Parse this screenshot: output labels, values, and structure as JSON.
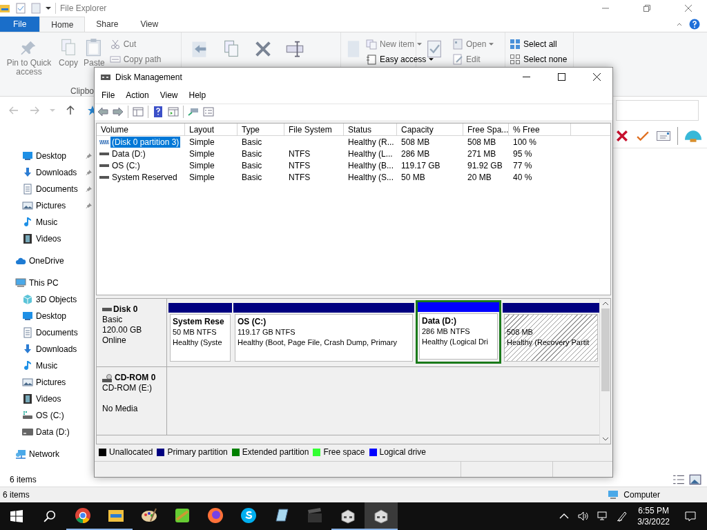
{
  "explorer": {
    "title": "File Explorer",
    "tabs": [
      {
        "label": "File",
        "kind": "file",
        "selected": false
      },
      {
        "label": "Home",
        "kind": "tab",
        "selected": true
      },
      {
        "label": "Share",
        "kind": "tab",
        "selected": false
      },
      {
        "label": "View",
        "kind": "tab",
        "selected": false
      }
    ],
    "ribbon": {
      "groups": [
        {
          "caption": "Clipbo",
          "large": [
            {
              "label": "Pin to Quick access",
              "kind": "pin",
              "disabled": true
            },
            {
              "label": "Copy",
              "kind": "copy",
              "disabled": true
            },
            {
              "label": "Paste",
              "kind": "paste",
              "disabled": true
            }
          ],
          "small": [
            {
              "label": "Cut",
              "kind": "scissors",
              "disabled": true,
              "dropdown": false
            },
            {
              "label": "Copy path",
              "kind": "path",
              "disabled": true,
              "dropdown": false
            }
          ]
        },
        {
          "large": [
            {
              "kind": "move"
            },
            {
              "kind": "copy"
            },
            {
              "kind": "delete"
            },
            {
              "kind": "rename"
            }
          ]
        },
        {
          "large": [
            {
              "kind": "newfolder"
            }
          ],
          "small": [
            {
              "label": "New item",
              "kind": "newitem",
              "disabled": true,
              "dropdown": true
            },
            {
              "label": "Easy access",
              "kind": "easy",
              "disabled": false,
              "dropdown": true
            }
          ]
        },
        {
          "large": [
            {
              "kind": "properties"
            }
          ],
          "small": [
            {
              "label": "Open",
              "kind": "open",
              "disabled": true,
              "dropdown": true
            },
            {
              "label": "Edit",
              "kind": "edit",
              "disabled": true,
              "dropdown": false
            }
          ]
        },
        {
          "small": [
            {
              "label": "Select all",
              "kind": "selectall",
              "disabled": false,
              "dropdown": false
            },
            {
              "label": "Select none",
              "kind": "selectnone",
              "disabled": false,
              "dropdown": false
            }
          ]
        }
      ]
    },
    "nav": {
      "quick_access": [
        {
          "label": "Desktop",
          "kind": "desktop",
          "pinned": true
        },
        {
          "label": "Downloads",
          "kind": "download",
          "pinned": true
        },
        {
          "label": "Documents",
          "kind": "document",
          "pinned": true
        },
        {
          "label": "Pictures",
          "kind": "picture",
          "pinned": true
        },
        {
          "label": "Music",
          "kind": "music",
          "pinned": false
        },
        {
          "label": "Videos",
          "kind": "video",
          "pinned": false
        }
      ],
      "places": [
        {
          "label": "OneDrive",
          "kind": "cloud"
        },
        {
          "label": "This PC",
          "kind": "computer",
          "children": [
            {
              "label": "3D Objects",
              "kind": "cube"
            },
            {
              "label": "Desktop",
              "kind": "desktop"
            },
            {
              "label": "Documents",
              "kind": "document"
            },
            {
              "label": "Downloads",
              "kind": "download"
            },
            {
              "label": "Music",
              "kind": "music"
            },
            {
              "label": "Pictures",
              "kind": "picture"
            },
            {
              "label": "Videos",
              "kind": "video"
            },
            {
              "label": "OS (C:)",
              "kind": "osdrive"
            },
            {
              "label": "Data (D:)",
              "kind": "drive"
            }
          ]
        },
        {
          "label": "Network",
          "kind": "network"
        }
      ]
    },
    "item_count": "6 items",
    "status_bar": {
      "count": "6 items",
      "location": "Computer"
    }
  },
  "disk_management": {
    "title": "Disk Management",
    "menu": [
      "File",
      "Action",
      "View",
      "Help"
    ],
    "table": {
      "columns": [
        "Volume",
        "Layout",
        "Type",
        "File System",
        "Status",
        "Capacity",
        "Free Spa...",
        "% Free"
      ],
      "rows": [
        {
          "kind": "recovery",
          "selected": true,
          "cells": [
            "(Disk 0 partition 3)",
            "Simple",
            "Basic",
            "",
            "Healthy (R...",
            "508 MB",
            "508 MB",
            "100 %"
          ]
        },
        {
          "kind": "drive",
          "selected": false,
          "cells": [
            "Data (D:)",
            "Simple",
            "Basic",
            "NTFS",
            "Healthy (L...",
            "286 MB",
            "271 MB",
            "95 %"
          ]
        },
        {
          "kind": "drive",
          "selected": false,
          "cells": [
            "OS (C:)",
            "Simple",
            "Basic",
            "NTFS",
            "Healthy (B...",
            "119.17 GB",
            "91.92 GB",
            "77 %"
          ]
        },
        {
          "kind": "drive",
          "selected": false,
          "cells": [
            "System Reserved",
            "Simple",
            "Basic",
            "NTFS",
            "Healthy (S...",
            "50 MB",
            "20 MB",
            "40 %"
          ]
        }
      ]
    },
    "disks": [
      {
        "name": "Disk 0",
        "kind": "disk",
        "lines": [
          "Basic",
          "120.00 GB",
          "Online"
        ],
        "partitions": [
          {
            "name": "System Rese",
            "size": "50 MB NTFS",
            "status": "Healthy (Syste",
            "color": "#000080",
            "extended": false,
            "selected": false
          },
          {
            "name": "OS  (C:)",
            "size": "119.17 GB NTFS",
            "status": "Healthy (Boot, Page File, Crash Dump, Primary",
            "color": "#000080",
            "extended": false,
            "selected": false
          },
          {
            "name": "Data  (D:)",
            "size": "286 MB NTFS",
            "status": "Healthy (Logical Dri",
            "color": "#0000ff",
            "extended": true,
            "selected": false
          },
          {
            "size": "508 MB",
            "status": "Healthy (Recovery Partit",
            "color": "#000080",
            "extended": false,
            "selected": true
          }
        ]
      },
      {
        "name": "CD-ROM 0",
        "kind": "cdrom",
        "lines": [
          "CD-ROM (E:)"
        ],
        "media": "No Media"
      }
    ],
    "legend": [
      {
        "label": "Unallocated",
        "color": "#000000"
      },
      {
        "label": "Primary partition",
        "color": "#000080"
      },
      {
        "label": "Extended partition",
        "color": "#008000"
      },
      {
        "label": "Free space",
        "color": "#33ff33"
      },
      {
        "label": "Logical drive",
        "color": "#0000ff"
      }
    ]
  },
  "taskbar": {
    "apps": [
      {
        "kind": "chrome",
        "open": true,
        "active": false
      },
      {
        "kind": "folder",
        "open": true,
        "active": false
      },
      {
        "kind": "palette",
        "open": false,
        "active": false
      },
      {
        "kind": "greenapp",
        "open": false,
        "active": false
      },
      {
        "kind": "firefox",
        "open": false,
        "active": false
      },
      {
        "kind": "skype",
        "open": false,
        "active": false
      },
      {
        "kind": "notepad",
        "open": false,
        "active": false
      },
      {
        "kind": "clapper",
        "open": false,
        "active": false
      },
      {
        "kind": "diskmgmt",
        "open": true,
        "active": false
      },
      {
        "kind": "diskmgmt",
        "open": true,
        "active": true
      }
    ],
    "clock": {
      "time": "6:55 PM",
      "date": "3/3/2022"
    }
  }
}
